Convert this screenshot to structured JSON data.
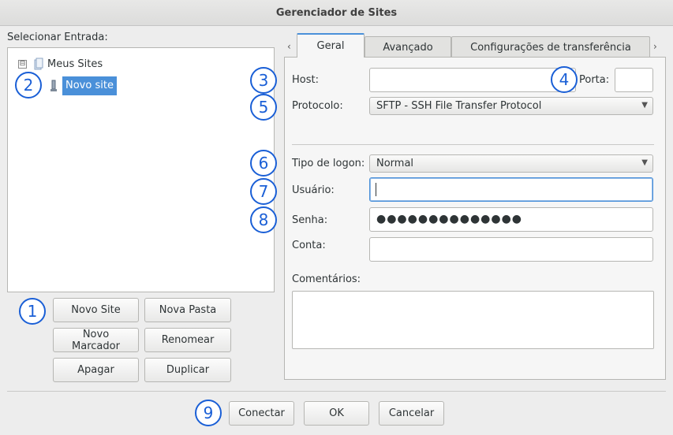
{
  "window": {
    "title": "Gerenciador de Sites"
  },
  "left": {
    "select_label": "Selecionar Entrada:",
    "tree": {
      "root": {
        "label": "Meus Sites",
        "expander": "⊟"
      },
      "child": {
        "label": "Novo site"
      }
    },
    "buttons": {
      "new_site": "Novo Site",
      "new_folder": "Nova Pasta",
      "new_bookmark": "Novo Marcador",
      "rename": "Renomear",
      "delete": "Apagar",
      "duplicate": "Duplicar"
    }
  },
  "tabs": {
    "prev_arrow": "‹",
    "next_arrow": "›",
    "general": "Geral",
    "advanced": "Avançado",
    "transfer": "Configurações de transferência"
  },
  "general": {
    "host_label": "Host:",
    "host_value": "",
    "port_label": "Porta:",
    "port_value": "",
    "protocol_label": "Protocolo:",
    "protocol_value": "SFTP - SSH File Transfer Protocol",
    "logon_label": "Tipo de logon:",
    "logon_value": "Normal",
    "user_label": "Usuário:",
    "user_value": "",
    "password_label": "Senha:",
    "password_mask": "●●●●●●●●●●●●●●",
    "account_label": "Conta:",
    "account_value": "",
    "comments_label": "Comentários:",
    "comments_value": ""
  },
  "footer": {
    "connect": "Conectar",
    "ok": "OK",
    "cancel": "Cancelar"
  },
  "annotations": [
    "1",
    "2",
    "3",
    "4",
    "5",
    "6",
    "7",
    "8",
    "9"
  ],
  "colors": {
    "accent": "#4a90d9",
    "annotation": "#1a5fd6"
  }
}
